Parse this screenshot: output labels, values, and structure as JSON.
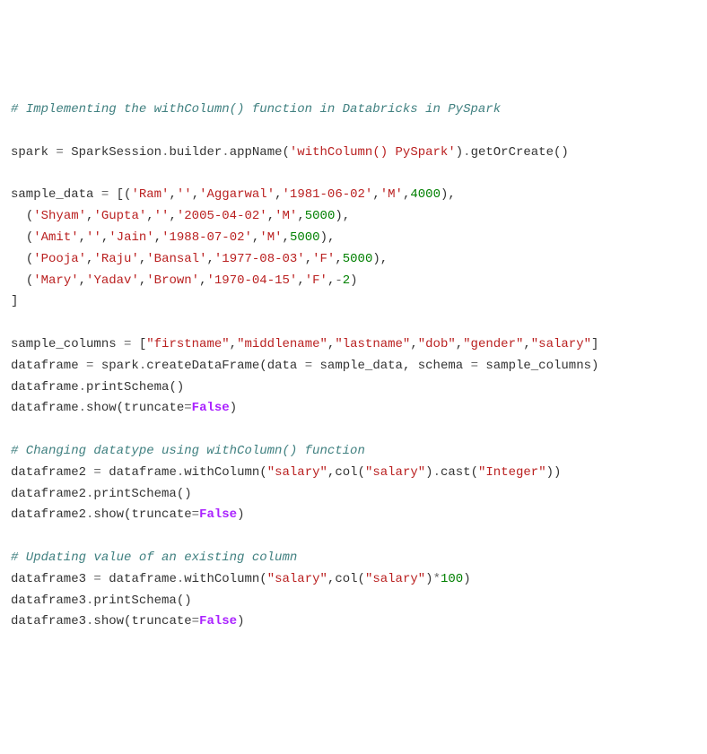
{
  "lines": [
    {
      "type": "comment",
      "text": "# Implementing the withColumn() function in Databricks in PySpark"
    },
    {
      "type": "blank"
    },
    {
      "type": "code",
      "tokens": [
        {
          "cls": "identifier",
          "t": "spark "
        },
        {
          "cls": "operator",
          "t": "= "
        },
        {
          "cls": "identifier",
          "t": "SparkSession"
        },
        {
          "cls": "operator",
          "t": "."
        },
        {
          "cls": "identifier",
          "t": "builder"
        },
        {
          "cls": "operator",
          "t": "."
        },
        {
          "cls": "identifier",
          "t": "appName"
        },
        {
          "cls": "paren",
          "t": "("
        },
        {
          "cls": "string",
          "t": "'withColumn() PySpark'"
        },
        {
          "cls": "paren",
          "t": ")"
        },
        {
          "cls": "operator",
          "t": "."
        },
        {
          "cls": "identifier",
          "t": "getOrCreate"
        },
        {
          "cls": "paren",
          "t": "()"
        }
      ]
    },
    {
      "type": "blank"
    },
    {
      "type": "code",
      "tokens": [
        {
          "cls": "identifier",
          "t": "sample_data "
        },
        {
          "cls": "operator",
          "t": "= "
        },
        {
          "cls": "paren",
          "t": "[("
        },
        {
          "cls": "string",
          "t": "'Ram'"
        },
        {
          "cls": "paren",
          "t": ","
        },
        {
          "cls": "string",
          "t": "''"
        },
        {
          "cls": "paren",
          "t": ","
        },
        {
          "cls": "string",
          "t": "'Aggarwal'"
        },
        {
          "cls": "paren",
          "t": ","
        },
        {
          "cls": "string",
          "t": "'1981-06-02'"
        },
        {
          "cls": "paren",
          "t": ","
        },
        {
          "cls": "string",
          "t": "'M'"
        },
        {
          "cls": "paren",
          "t": ","
        },
        {
          "cls": "number",
          "t": "4000"
        },
        {
          "cls": "paren",
          "t": "),"
        }
      ]
    },
    {
      "type": "code",
      "tokens": [
        {
          "cls": "identifier",
          "t": "  "
        },
        {
          "cls": "paren",
          "t": "("
        },
        {
          "cls": "string",
          "t": "'Shyam'"
        },
        {
          "cls": "paren",
          "t": ","
        },
        {
          "cls": "string",
          "t": "'Gupta'"
        },
        {
          "cls": "paren",
          "t": ","
        },
        {
          "cls": "string",
          "t": "''"
        },
        {
          "cls": "paren",
          "t": ","
        },
        {
          "cls": "string",
          "t": "'2005-04-02'"
        },
        {
          "cls": "paren",
          "t": ","
        },
        {
          "cls": "string",
          "t": "'M'"
        },
        {
          "cls": "paren",
          "t": ","
        },
        {
          "cls": "number",
          "t": "5000"
        },
        {
          "cls": "paren",
          "t": "),"
        }
      ]
    },
    {
      "type": "code",
      "tokens": [
        {
          "cls": "identifier",
          "t": "  "
        },
        {
          "cls": "paren",
          "t": "("
        },
        {
          "cls": "string",
          "t": "'Amit'"
        },
        {
          "cls": "paren",
          "t": ","
        },
        {
          "cls": "string",
          "t": "''"
        },
        {
          "cls": "paren",
          "t": ","
        },
        {
          "cls": "string",
          "t": "'Jain'"
        },
        {
          "cls": "paren",
          "t": ","
        },
        {
          "cls": "string",
          "t": "'1988-07-02'"
        },
        {
          "cls": "paren",
          "t": ","
        },
        {
          "cls": "string",
          "t": "'M'"
        },
        {
          "cls": "paren",
          "t": ","
        },
        {
          "cls": "number",
          "t": "5000"
        },
        {
          "cls": "paren",
          "t": "),"
        }
      ]
    },
    {
      "type": "code",
      "tokens": [
        {
          "cls": "identifier",
          "t": "  "
        },
        {
          "cls": "paren",
          "t": "("
        },
        {
          "cls": "string",
          "t": "'Pooja'"
        },
        {
          "cls": "paren",
          "t": ","
        },
        {
          "cls": "string",
          "t": "'Raju'"
        },
        {
          "cls": "paren",
          "t": ","
        },
        {
          "cls": "string",
          "t": "'Bansal'"
        },
        {
          "cls": "paren",
          "t": ","
        },
        {
          "cls": "string",
          "t": "'1977-08-03'"
        },
        {
          "cls": "paren",
          "t": ","
        },
        {
          "cls": "string",
          "t": "'F'"
        },
        {
          "cls": "paren",
          "t": ","
        },
        {
          "cls": "number",
          "t": "5000"
        },
        {
          "cls": "paren",
          "t": "),"
        }
      ]
    },
    {
      "type": "code",
      "tokens": [
        {
          "cls": "identifier",
          "t": "  "
        },
        {
          "cls": "paren",
          "t": "("
        },
        {
          "cls": "string",
          "t": "'Mary'"
        },
        {
          "cls": "paren",
          "t": ","
        },
        {
          "cls": "string",
          "t": "'Yadav'"
        },
        {
          "cls": "paren",
          "t": ","
        },
        {
          "cls": "string",
          "t": "'Brown'"
        },
        {
          "cls": "paren",
          "t": ","
        },
        {
          "cls": "string",
          "t": "'1970-04-15'"
        },
        {
          "cls": "paren",
          "t": ","
        },
        {
          "cls": "string",
          "t": "'F'"
        },
        {
          "cls": "paren",
          "t": ","
        },
        {
          "cls": "operator",
          "t": "-"
        },
        {
          "cls": "number",
          "t": "2"
        },
        {
          "cls": "paren",
          "t": ")"
        }
      ]
    },
    {
      "type": "code",
      "tokens": [
        {
          "cls": "paren",
          "t": "]"
        }
      ]
    },
    {
      "type": "blank"
    },
    {
      "type": "code",
      "tokens": [
        {
          "cls": "identifier",
          "t": "sample_columns "
        },
        {
          "cls": "operator",
          "t": "= "
        },
        {
          "cls": "paren",
          "t": "["
        },
        {
          "cls": "string",
          "t": "\"firstname\""
        },
        {
          "cls": "paren",
          "t": ","
        },
        {
          "cls": "string",
          "t": "\"middlename\""
        },
        {
          "cls": "paren",
          "t": ","
        },
        {
          "cls": "string",
          "t": "\"lastname\""
        },
        {
          "cls": "paren",
          "t": ","
        },
        {
          "cls": "string",
          "t": "\"dob\""
        },
        {
          "cls": "paren",
          "t": ","
        },
        {
          "cls": "string",
          "t": "\"gender\""
        },
        {
          "cls": "paren",
          "t": ","
        },
        {
          "cls": "string",
          "t": "\"salary\""
        },
        {
          "cls": "paren",
          "t": "]"
        }
      ]
    },
    {
      "type": "code",
      "tokens": [
        {
          "cls": "identifier",
          "t": "dataframe "
        },
        {
          "cls": "operator",
          "t": "= "
        },
        {
          "cls": "identifier",
          "t": "spark"
        },
        {
          "cls": "operator",
          "t": "."
        },
        {
          "cls": "identifier",
          "t": "createDataFrame"
        },
        {
          "cls": "paren",
          "t": "("
        },
        {
          "cls": "identifier",
          "t": "data "
        },
        {
          "cls": "operator",
          "t": "= "
        },
        {
          "cls": "identifier",
          "t": "sample_data"
        },
        {
          "cls": "paren",
          "t": ", "
        },
        {
          "cls": "identifier",
          "t": "schema "
        },
        {
          "cls": "operator",
          "t": "= "
        },
        {
          "cls": "identifier",
          "t": "sample_columns"
        },
        {
          "cls": "paren",
          "t": ")"
        }
      ]
    },
    {
      "type": "code",
      "tokens": [
        {
          "cls": "identifier",
          "t": "dataframe"
        },
        {
          "cls": "operator",
          "t": "."
        },
        {
          "cls": "identifier",
          "t": "printSchema"
        },
        {
          "cls": "paren",
          "t": "()"
        }
      ]
    },
    {
      "type": "code",
      "tokens": [
        {
          "cls": "identifier",
          "t": "dataframe"
        },
        {
          "cls": "operator",
          "t": "."
        },
        {
          "cls": "identifier",
          "t": "show"
        },
        {
          "cls": "paren",
          "t": "("
        },
        {
          "cls": "identifier",
          "t": "truncate"
        },
        {
          "cls": "operator",
          "t": "="
        },
        {
          "cls": "boolconst",
          "t": "False"
        },
        {
          "cls": "paren",
          "t": ")"
        }
      ]
    },
    {
      "type": "blank"
    },
    {
      "type": "comment",
      "text": "# Changing datatype using withColumn() function"
    },
    {
      "type": "code",
      "tokens": [
        {
          "cls": "identifier",
          "t": "dataframe2 "
        },
        {
          "cls": "operator",
          "t": "= "
        },
        {
          "cls": "identifier",
          "t": "dataframe"
        },
        {
          "cls": "operator",
          "t": "."
        },
        {
          "cls": "identifier",
          "t": "withColumn"
        },
        {
          "cls": "paren",
          "t": "("
        },
        {
          "cls": "string",
          "t": "\"salary\""
        },
        {
          "cls": "paren",
          "t": ","
        },
        {
          "cls": "identifier",
          "t": "col"
        },
        {
          "cls": "paren",
          "t": "("
        },
        {
          "cls": "string",
          "t": "\"salary\""
        },
        {
          "cls": "paren",
          "t": ")"
        },
        {
          "cls": "operator",
          "t": "."
        },
        {
          "cls": "identifier",
          "t": "cast"
        },
        {
          "cls": "paren",
          "t": "("
        },
        {
          "cls": "string",
          "t": "\"Integer\""
        },
        {
          "cls": "paren",
          "t": "))"
        }
      ]
    },
    {
      "type": "code",
      "tokens": [
        {
          "cls": "identifier",
          "t": "dataframe2"
        },
        {
          "cls": "operator",
          "t": "."
        },
        {
          "cls": "identifier",
          "t": "printSchema"
        },
        {
          "cls": "paren",
          "t": "()"
        }
      ]
    },
    {
      "type": "code",
      "tokens": [
        {
          "cls": "identifier",
          "t": "dataframe2"
        },
        {
          "cls": "operator",
          "t": "."
        },
        {
          "cls": "identifier",
          "t": "show"
        },
        {
          "cls": "paren",
          "t": "("
        },
        {
          "cls": "identifier",
          "t": "truncate"
        },
        {
          "cls": "operator",
          "t": "="
        },
        {
          "cls": "boolconst",
          "t": "False"
        },
        {
          "cls": "paren",
          "t": ")"
        }
      ]
    },
    {
      "type": "blank"
    },
    {
      "type": "comment",
      "text": "# Updating value of an existing column"
    },
    {
      "type": "code",
      "tokens": [
        {
          "cls": "identifier",
          "t": "dataframe3 "
        },
        {
          "cls": "operator",
          "t": "= "
        },
        {
          "cls": "identifier",
          "t": "dataframe"
        },
        {
          "cls": "operator",
          "t": "."
        },
        {
          "cls": "identifier",
          "t": "withColumn"
        },
        {
          "cls": "paren",
          "t": "("
        },
        {
          "cls": "string",
          "t": "\"salary\""
        },
        {
          "cls": "paren",
          "t": ","
        },
        {
          "cls": "identifier",
          "t": "col"
        },
        {
          "cls": "paren",
          "t": "("
        },
        {
          "cls": "string",
          "t": "\"salary\""
        },
        {
          "cls": "paren",
          "t": ")"
        },
        {
          "cls": "operator",
          "t": "*"
        },
        {
          "cls": "number",
          "t": "100"
        },
        {
          "cls": "paren",
          "t": ")"
        }
      ]
    },
    {
      "type": "code",
      "tokens": [
        {
          "cls": "identifier",
          "t": "dataframe3"
        },
        {
          "cls": "operator",
          "t": "."
        },
        {
          "cls": "identifier",
          "t": "printSchema"
        },
        {
          "cls": "paren",
          "t": "()"
        }
      ]
    },
    {
      "type": "code",
      "tokens": [
        {
          "cls": "identifier",
          "t": "dataframe3"
        },
        {
          "cls": "operator",
          "t": "."
        },
        {
          "cls": "identifier",
          "t": "show"
        },
        {
          "cls": "paren",
          "t": "("
        },
        {
          "cls": "identifier",
          "t": "truncate"
        },
        {
          "cls": "operator",
          "t": "="
        },
        {
          "cls": "boolconst",
          "t": "False"
        },
        {
          "cls": "paren",
          "t": ")"
        }
      ]
    }
  ]
}
